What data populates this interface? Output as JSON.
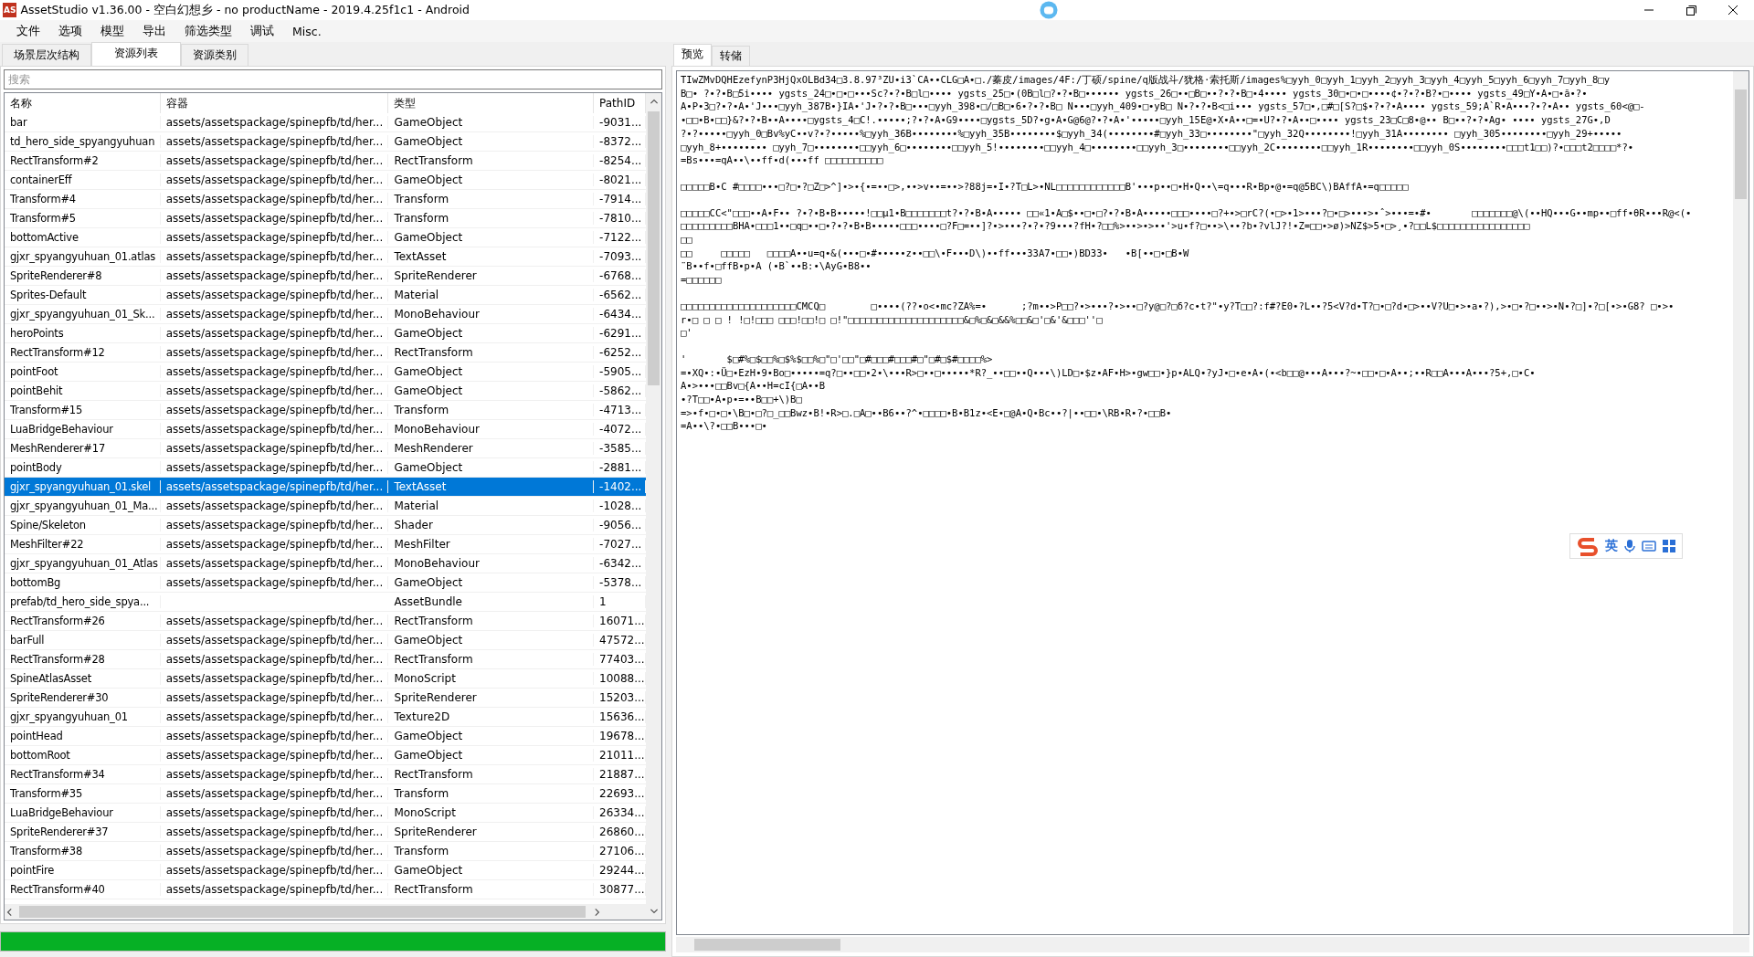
{
  "window": {
    "title": "AssetStudio v1.36.00 - 空白幻想乡 - no productName - 2019.4.25f1c1 - Android",
    "app_icon": "AS"
  },
  "menu": [
    "文件",
    "选项",
    "模型",
    "导出",
    "筛选类型",
    "调试",
    "Misc."
  ],
  "left_tabs": [
    {
      "label": "场景层次结构",
      "selected": false
    },
    {
      "label": "资源列表",
      "selected": true
    },
    {
      "label": "资源类别",
      "selected": false
    }
  ],
  "search": {
    "placeholder": "搜索"
  },
  "table": {
    "columns": [
      "名称",
      "容器",
      "类型",
      "PathID"
    ],
    "rows": [
      {
        "name": "bar",
        "container": "assets/assetspackage/spinepfb/td/her...",
        "type": "GameObject",
        "path_id": "-9031...",
        "selected": false
      },
      {
        "name": "td_hero_side_spyangyuhuan",
        "container": "assets/assetspackage/spinepfb/td/her...",
        "type": "GameObject",
        "path_id": "-8372...",
        "selected": false
      },
      {
        "name": "RectTransform#2",
        "container": "assets/assetspackage/spinepfb/td/her...",
        "type": "RectTransform",
        "path_id": "-8254...",
        "selected": false
      },
      {
        "name": "containerEff",
        "container": "assets/assetspackage/spinepfb/td/her...",
        "type": "GameObject",
        "path_id": "-8021...",
        "selected": false
      },
      {
        "name": "Transform#4",
        "container": "assets/assetspackage/spinepfb/td/her...",
        "type": "Transform",
        "path_id": "-7914...",
        "selected": false
      },
      {
        "name": "Transform#5",
        "container": "assets/assetspackage/spinepfb/td/her...",
        "type": "Transform",
        "path_id": "-7810...",
        "selected": false
      },
      {
        "name": "bottomActive",
        "container": "assets/assetspackage/spinepfb/td/her...",
        "type": "GameObject",
        "path_id": "-7122...",
        "selected": false
      },
      {
        "name": "gjxr_spyangyuhuan_01.atlas",
        "container": "assets/assetspackage/spinepfb/td/her...",
        "type": "TextAsset",
        "path_id": "-7093...",
        "selected": false
      },
      {
        "name": "SpriteRenderer#8",
        "container": "assets/assetspackage/spinepfb/td/her...",
        "type": "SpriteRenderer",
        "path_id": "-6768...",
        "selected": false
      },
      {
        "name": "Sprites-Default",
        "container": "assets/assetspackage/spinepfb/td/her...",
        "type": "Material",
        "path_id": "-6562...",
        "selected": false
      },
      {
        "name": "gjxr_spyangyuhuan_01_Sk...",
        "container": "assets/assetspackage/spinepfb/td/her...",
        "type": "MonoBehaviour",
        "path_id": "-6434...",
        "selected": false
      },
      {
        "name": "heroPoints",
        "container": "assets/assetspackage/spinepfb/td/her...",
        "type": "GameObject",
        "path_id": "-6291...",
        "selected": false
      },
      {
        "name": "RectTransform#12",
        "container": "assets/assetspackage/spinepfb/td/her...",
        "type": "RectTransform",
        "path_id": "-6252...",
        "selected": false
      },
      {
        "name": "pointFoot",
        "container": "assets/assetspackage/spinepfb/td/her...",
        "type": "GameObject",
        "path_id": "-5905...",
        "selected": false
      },
      {
        "name": "pointBehit",
        "container": "assets/assetspackage/spinepfb/td/her...",
        "type": "GameObject",
        "path_id": "-5862...",
        "selected": false
      },
      {
        "name": "Transform#15",
        "container": "assets/assetspackage/spinepfb/td/her...",
        "type": "Transform",
        "path_id": "-4713...",
        "selected": false
      },
      {
        "name": "LuaBridgeBehaviour",
        "container": "assets/assetspackage/spinepfb/td/her...",
        "type": "MonoBehaviour",
        "path_id": "-4072...",
        "selected": false
      },
      {
        "name": "MeshRenderer#17",
        "container": "assets/assetspackage/spinepfb/td/her...",
        "type": "MeshRenderer",
        "path_id": "-3585...",
        "selected": false
      },
      {
        "name": "pointBody",
        "container": "assets/assetspackage/spinepfb/td/her...",
        "type": "GameObject",
        "path_id": "-2881...",
        "selected": false
      },
      {
        "name": "gjxr_spyangyuhuan_01.skel",
        "container": "assets/assetspackage/spinepfb/td/her...",
        "type": "TextAsset",
        "path_id": "-1402...",
        "selected": true
      },
      {
        "name": "gjxr_spyangyuhuan_01_Ma...",
        "container": "assets/assetspackage/spinepfb/td/her...",
        "type": "Material",
        "path_id": "-1028...",
        "selected": false
      },
      {
        "name": "Spine/Skeleton",
        "container": "assets/assetspackage/spinepfb/td/her...",
        "type": "Shader",
        "path_id": "-9056...",
        "selected": false
      },
      {
        "name": "MeshFilter#22",
        "container": "assets/assetspackage/spinepfb/td/her...",
        "type": "MeshFilter",
        "path_id": "-7027...",
        "selected": false
      },
      {
        "name": "gjxr_spyangyuhuan_01_Atlas",
        "container": "assets/assetspackage/spinepfb/td/her...",
        "type": "MonoBehaviour",
        "path_id": "-6342...",
        "selected": false
      },
      {
        "name": "bottomBg",
        "container": "assets/assetspackage/spinepfb/td/her...",
        "type": "GameObject",
        "path_id": "-5378...",
        "selected": false
      },
      {
        "name": "prefab/td_hero_side_spya...",
        "type": "AssetBundle",
        "path_id": "1",
        "selected": false
      },
      {
        "name": "RectTransform#26",
        "container": "assets/assetspackage/spinepfb/td/her...",
        "type": "RectTransform",
        "path_id": "16071...",
        "selected": false
      },
      {
        "name": "barFull",
        "container": "assets/assetspackage/spinepfb/td/her...",
        "type": "GameObject",
        "path_id": "47572...",
        "selected": false
      },
      {
        "name": "RectTransform#28",
        "container": "assets/assetspackage/spinepfb/td/her...",
        "type": "RectTransform",
        "path_id": "77403...",
        "selected": false
      },
      {
        "name": "SpineAtlasAsset",
        "container": "assets/assetspackage/spinepfb/td/her...",
        "type": "MonoScript",
        "path_id": "10088...",
        "selected": false
      },
      {
        "name": "SpriteRenderer#30",
        "container": "assets/assetspackage/spinepfb/td/her...",
        "type": "SpriteRenderer",
        "path_id": "15203...",
        "selected": false
      },
      {
        "name": "gjxr_spyangyuhuan_01",
        "container": "assets/assetspackage/spinepfb/td/her...",
        "type": "Texture2D",
        "path_id": "15636...",
        "selected": false
      },
      {
        "name": "pointHead",
        "container": "assets/assetspackage/spinepfb/td/her...",
        "type": "GameObject",
        "path_id": "19678...",
        "selected": false
      },
      {
        "name": "bottomRoot",
        "container": "assets/assetspackage/spinepfb/td/her...",
        "type": "GameObject",
        "path_id": "21011...",
        "selected": false
      },
      {
        "name": "RectTransform#34",
        "container": "assets/assetspackage/spinepfb/td/her...",
        "type": "RectTransform",
        "path_id": "21887...",
        "selected": false
      },
      {
        "name": "Transform#35",
        "container": "assets/assetspackage/spinepfb/td/her...",
        "type": "Transform",
        "path_id": "22693...",
        "selected": false
      },
      {
        "name": "LuaBridgeBehaviour",
        "container": "assets/assetspackage/spinepfb/td/her...",
        "type": "MonoScript",
        "path_id": "26334...",
        "selected": false
      },
      {
        "name": "SpriteRenderer#37",
        "container": "assets/assetspackage/spinepfb/td/her...",
        "type": "SpriteRenderer",
        "path_id": "26860...",
        "selected": false
      },
      {
        "name": "Transform#38",
        "container": "assets/assetspackage/spinepfb/td/her...",
        "type": "Transform",
        "path_id": "27106...",
        "selected": false
      },
      {
        "name": "pointFire",
        "container": "assets/assetspackage/spinepfb/td/her...",
        "type": "GameObject",
        "path_id": "29244...",
        "selected": false
      },
      {
        "name": "RectTransform#40",
        "container": "assets/assetspackage/spinepfb/td/her...",
        "type": "RectTransform",
        "path_id": "30877...",
        "selected": false
      }
    ]
  },
  "progress": {
    "level": 1.0
  },
  "right_tabs": [
    {
      "label": "预览",
      "selected": true
    },
    {
      "label": "转储",
      "selected": false
    }
  ],
  "preview": {
    "paragraphs": [
      [
        "TIwZMvDQHEzefynP3HjQxOLBd34□3.8.97³ZU•i3`CA••CLG□A•□./蓁皮/images/4F:/丁硕/spine/q版战斗/犹格·索托斯/images%□yyh_0□yyh_1□yyh_2□yyh_3□yyh_4□yyh_5□yyh_6□yyh_7□yyh_8□y",
        "B□• ?•?•B□5i•••• ygsts_24□•□•□•••Sc?•?•B□l□•••• ygsts_25□•(0B□l□?•?•B□•••••• ygsts_26□••□B□••?•?•B□•4•••• ygsts_30□•□•□••••¢•?•?•B?•□•••• ygsts_49□Y•A•□•ã•?•",
        "A•P•3□?•?•A•'J•••□yyh_387B•}IA•'J•?•?•B□•••□yyh_398•□/□B□•6•?•?•B□ N•••□yyh_409•□•yB□ N•?•?•B<□i••• ygsts_57□•,□#□[S?□$•?•?•A•••• ygsts_59;A`R•A•••?•?•A•• ygsts_60<@□-",
        "•□□•B•□□}&?•?•B••A••••□ygsts_4□C!.•••••;?•?•A•G9••••□ygsts_5D?•g•A•G@6@?•?•A•'•••••□yyh_15E@•X•A••□=•U?•?•A••□•••• ygsts_23□C□8•@•• B□••?•?•Ag• •••• ygsts_27G•,D",
        "?•?•••••□yyh_0□Bv%yC••v?•?•••••%□yyh_36B••••••••%□yyh_35B••••••••$□yyh_34(••••••••#□yyh_33□••••••••\"□yyh_32Q••••••••!□yyh_31A•••••••• □yyh_305••••••••□yyh_29+•••••",
        "□yyh_8+•••••••• □yyh_7□••••••••□□yyh_6□••••••••□□yyh_5!••••••••□□yyh_4□••••••••□□yyh_3□••••••••□□yyh_2C••••••••□□yyh_1R••••••••□□yyh_0S••••••••□□□t1□□)?•□□□t2□□□□*?•",
        "=Bs•••=qA••\\••ff•d(•••ff □□□□□□□□□□"
      ],
      [
        "□□□□□B•C #□□□□•••□?□•?□Z□>^]•>•{•=••□>,••>v••=••>?88j=•I•?T□L>•NL□□□□□□□□□□□□B'•••p••□•H•Q••\\=q•••R•Bp•@•=q@5BC\\)BAffA•=q□□□□□"
      ],
      [
        "□□□□□CC<\"□□□••A•F•• ?•?•B•B•••••!□□µ1•B□□□□□□□t?•?•B•A••••• □□«1•A□$••□•□?•?•B•A•••••□□□••••□?+•>□rC?(•□>•1>•••?□•□>•••>•ˆ>•••=•#•       □□□□□□□@\\(••HQ•••G••mp••□ff•θR•••R@<(•",
        "□□□□□□□□□BHA•□□□1••□q□••□•?•?•B•B•••••□□□••••□?F□=••]?•>•••?•?•?9•••?fH•?□□%>••>•>••'>u•f?□••>\\••?b•?vlJ?!•Z=□□•>ø)>NZ$>5•□>¸•?□□L$□□□□□□□□□□□□□□□□",
        "□□",
        "□□     □□□□□   □□□□A••u=q•&(•••□•#•••••z••□□\\•F•••D\\)••ff•••33A7•□□•)BD33•   •B[••□•□B•W",
        "¨B••f•□ffB•p•A (•B`••B:•\\AyG•B8••",
        "=□□□□□□"
      ],
      [
        "□□□□□□□□□□□□□□□□□□□□CMCQ□        □••••(??•o<•mc?ZA%=•      ;?m••>P□□?•>•••?•>••□?y@□?□δ?c•t?\"•y?T□□?:f#?E0•?L••?5<V?d•T?□•□?d•□>••V?U□•>•a•?),>•□•?□••>•N•?□]•?□[•>•G8? □•>•",
        "r•□ □ □ ! !□!□□□ □□□!□□!□ □!\"□□□□□□□□□□□□□□□□□□□□&□%□&□&&%□□&□'□&'&□□□''□",
        "□'"
      ],
      [
        "'       $□#%□$□□%□$%$□□%□\"□'□□\"□#□□□#□□□#□\"□#□$#□□□□%>",
        "=•XQ•:•Ü□•EzH•9•Bo□•••••=q?□••□□•2•\\•••R>□••□•••••*R?_••□□••Q•••\\)LD□•$z•AF•H>•gw□□•}p•ALQ•?yJ•□•e•A•(•<b□□@•••A•••?~•□□•□•A••;••R□□A•••A•••?5+,□•C•",
        "A•>•••□□Bv□{A••H=cI{□A••B",
        "•?T□□•A•p•=••B□□+\\)B□",
        "=>•f•□•□•\\B□•□?□_□□Bwz•B!•R>□.□A□••B6••?^•□□□□•B•B1z•<E•□@A•Q•Bc••?|••□□•\\RB•R•?•□□B•",
        "=A••\\?•□□B•••□•"
      ]
    ]
  },
  "ime": {
    "mode": "英"
  }
}
